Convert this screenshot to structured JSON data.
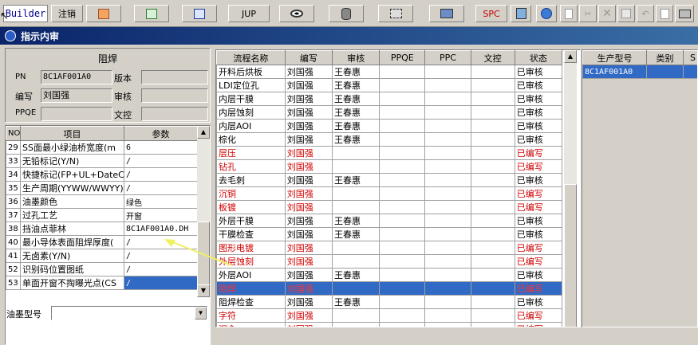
{
  "toolbar": {
    "builder": "Builder",
    "logout": "注销",
    "jup": "JUP",
    "spc": "SPC",
    "icons": [
      "ppt-icon",
      "excel-icon",
      "word-icon",
      "eye-icon",
      "database-icon",
      "network-icon",
      "computer-icon",
      "calculator-icon",
      "ie-icon",
      "new-doc-icon",
      "cut-icon",
      "delete-icon",
      "save-icon",
      "undo-icon",
      "preview-icon",
      "print-icon"
    ]
  },
  "window": {
    "title": "指示内审"
  },
  "left": {
    "section_title": "阻焊",
    "pn_label": "PN",
    "pn_value": "8C1AF001A0",
    "version_label": "版本",
    "author_label": "编写",
    "author_value": "刘国强",
    "review_label": "审核",
    "ppqe_label": "PPQE",
    "doc_label": "文控",
    "grid_headers": [
      "NO",
      "项目",
      "参数"
    ],
    "rows": [
      {
        "no": "29",
        "item": "SS面最小绿油桥宽度(m",
        "param": "6"
      },
      {
        "no": "33",
        "item": "无铅标记(Y/N)",
        "param": "/"
      },
      {
        "no": "34",
        "item": "快捷标记(FP+UL+DateCo",
        "param": "/"
      },
      {
        "no": "35",
        "item": "生产周期(YYWW/WWYY)",
        "param": "/"
      },
      {
        "no": "36",
        "item": "油墨颜色",
        "param": "绿色"
      },
      {
        "no": "37",
        "item": "过孔工艺",
        "param": "开窗"
      },
      {
        "no": "38",
        "item": "挡油点菲林",
        "param": "8C1AF001A0.DH"
      },
      {
        "no": "40",
        "item": "最小导体表面阻焊厚度(",
        "param": "/"
      },
      {
        "no": "41",
        "item": "无卤素(Y/N)",
        "param": "/"
      },
      {
        "no": "52",
        "item": "识别码位置图纸",
        "param": "/"
      },
      {
        "no": "53",
        "item": "单面开窗不掏曝光点(CS",
        "param": "/"
      }
    ],
    "ink_label": "油墨型号"
  },
  "middle": {
    "headers": [
      "流程名称",
      "编写",
      "审核",
      "PPQE",
      "PPC",
      "文控",
      "状态"
    ],
    "rows": [
      {
        "name": "开料后烘板",
        "author": "刘国强",
        "reviewer": "王春惠",
        "status": "已审核",
        "state": "ok"
      },
      {
        "name": "LDI定位孔",
        "author": "刘国强",
        "reviewer": "王春惠",
        "status": "已审核",
        "state": "ok"
      },
      {
        "name": "内层干膜",
        "author": "刘国强",
        "reviewer": "王春惠",
        "status": "已审核",
        "state": "ok"
      },
      {
        "name": "内层蚀刻",
        "author": "刘国强",
        "reviewer": "王春惠",
        "status": "已审核",
        "state": "ok"
      },
      {
        "name": "内层AOI",
        "author": "刘国强",
        "reviewer": "王春惠",
        "status": "已审核",
        "state": "ok"
      },
      {
        "name": "棕化",
        "author": "刘国强",
        "reviewer": "王春惠",
        "status": "已审核",
        "state": "ok"
      },
      {
        "name": "层压",
        "author": "刘国强",
        "reviewer": "",
        "status": "已编写",
        "state": "red"
      },
      {
        "name": "钻孔",
        "author": "刘国强",
        "reviewer": "",
        "status": "已编写",
        "state": "red"
      },
      {
        "name": "去毛刺",
        "author": "刘国强",
        "reviewer": "王春惠",
        "status": "已审核",
        "state": "ok"
      },
      {
        "name": "沉铜",
        "author": "刘国强",
        "reviewer": "",
        "status": "已编写",
        "state": "red"
      },
      {
        "name": "板镀",
        "author": "刘国强",
        "reviewer": "",
        "status": "已编写",
        "state": "red"
      },
      {
        "name": "外层干膜",
        "author": "刘国强",
        "reviewer": "王春惠",
        "status": "已审核",
        "state": "ok"
      },
      {
        "name": "干膜检查",
        "author": "刘国强",
        "reviewer": "王春惠",
        "status": "已审核",
        "state": "ok"
      },
      {
        "name": "图形电镀",
        "author": "刘国强",
        "reviewer": "",
        "status": "已编写",
        "state": "red"
      },
      {
        "name": "外层蚀刻",
        "author": "刘国强",
        "reviewer": "",
        "status": "已编写",
        "state": "red"
      },
      {
        "name": "外层AOI",
        "author": "刘国强",
        "reviewer": "王春惠",
        "status": "已审核",
        "state": "ok"
      },
      {
        "name": "阻焊",
        "author": "刘国强",
        "reviewer": "",
        "status": "已编写",
        "state": "sel"
      },
      {
        "name": "阻焊检查",
        "author": "刘国强",
        "reviewer": "王春惠",
        "status": "已审核",
        "state": "ok"
      },
      {
        "name": "字符",
        "author": "刘国强",
        "reviewer": "",
        "status": "已编写",
        "state": "red"
      },
      {
        "name": "沉金",
        "author": "刘国强",
        "reviewer": "",
        "status": "已编写",
        "state": "red"
      }
    ]
  },
  "right": {
    "headers": [
      "生产型号",
      "类别",
      "S"
    ],
    "rows": [
      {
        "model": "8C1AF001A0",
        "cat": "",
        "s": ""
      }
    ]
  }
}
